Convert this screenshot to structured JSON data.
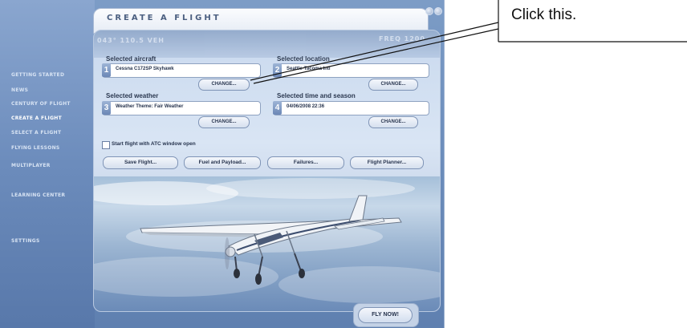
{
  "window": {
    "title": "CREATE A FLIGHT",
    "decor_text_1": "043° 110.5 VEH",
    "decor_text_2": "FREQ 1200"
  },
  "sidebar": {
    "items": [
      {
        "label": "GETTING STARTED",
        "active": false
      },
      {
        "label": "NEWS",
        "active": false
      },
      {
        "label": "CENTURY OF FLIGHT",
        "active": false
      },
      {
        "label": "CREATE A FLIGHT",
        "active": true
      },
      {
        "label": "SELECT A FLIGHT",
        "active": false
      },
      {
        "label": "FLYING LESSONS",
        "active": false
      },
      {
        "label": "MULTIPLAYER",
        "active": false
      },
      {
        "label": "LEARNING CENTER",
        "active": false
      },
      {
        "label": "SETTINGS",
        "active": false
      }
    ]
  },
  "sections": {
    "aircraft": {
      "label": "Selected aircraft",
      "number": "1",
      "value": "Cessna C172SP Skyhawk",
      "button": "CHANGE..."
    },
    "location": {
      "label": "Selected location",
      "number": "2",
      "value": "Seattle-Tacoma Intl",
      "button": "CHANGE..."
    },
    "weather": {
      "label": "Selected weather",
      "number": "3",
      "value": "Weather Theme: Fair Weather",
      "button": "CHANGE..."
    },
    "time": {
      "label": "Selected time and season",
      "number": "4",
      "value": "04/06/2008 22:36",
      "button": "CHANGE..."
    }
  },
  "atc_checkbox": {
    "label": "Start flight with ATC window open",
    "checked": false
  },
  "actions": {
    "save": "Save Flight...",
    "fuel": "Fuel and Payload...",
    "failures": "Failures...",
    "planner": "Flight Planner..."
  },
  "fly_now": "FLY NOW!",
  "callout": {
    "text": "Click this."
  }
}
